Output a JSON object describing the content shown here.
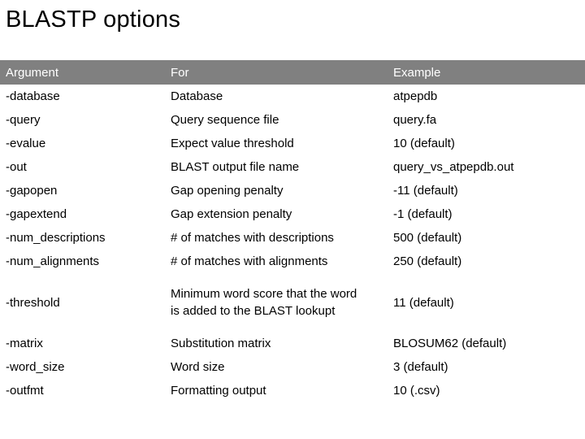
{
  "title": "BLASTP options",
  "table": {
    "headers": {
      "argument": "Argument",
      "for": "For",
      "example": "Example"
    },
    "header_bg": "#808080",
    "rows": [
      {
        "argument": "-database",
        "for": "Database",
        "example": "atpepdb"
      },
      {
        "argument": "-query",
        "for": "Query sequence file",
        "example": "query.fa"
      },
      {
        "argument": "-evalue",
        "for": "Expect value threshold",
        "example": "10 (default)"
      },
      {
        "argument": "-out",
        "for": "BLAST output file name",
        "example": "query_vs_atpepdb.out"
      },
      {
        "argument": "-gapopen",
        "for": "Gap opening penalty",
        "example": "-11 (default)"
      },
      {
        "argument": "-gapextend",
        "for": "Gap extension penalty",
        "example": "-1 (default)"
      },
      {
        "argument": "-num_descriptions",
        "for": "# of matches with descriptions",
        "example": "500 (default)"
      },
      {
        "argument": "-num_alignments",
        "for": "# of matches with alignments",
        "example": "250 (default)"
      },
      {
        "argument": "-threshold",
        "for": "Minimum word score that the word is added to the BLAST lookupt",
        "example": "11 (default)"
      },
      {
        "argument": "-matrix",
        "for": "Substitution matrix",
        "example": "BLOSUM62 (default)"
      },
      {
        "argument": "-word_size",
        "for": "Word size",
        "example": "3 (default)"
      },
      {
        "argument": "-outfmt",
        "for": "Formatting output",
        "example": "10 (.csv)"
      }
    ]
  }
}
